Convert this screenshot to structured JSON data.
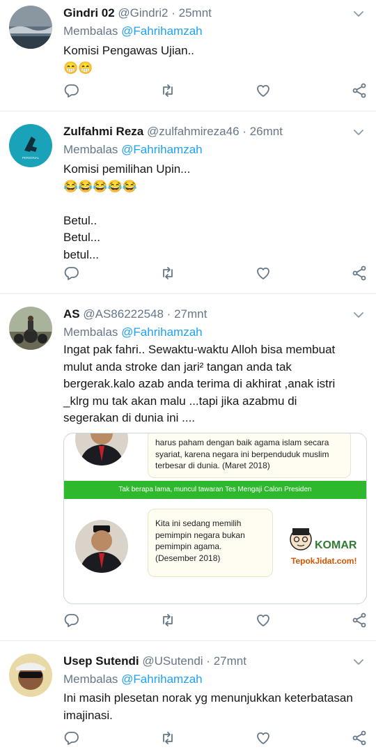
{
  "reply_prefix": "Membalas",
  "colors": {
    "accent": "#1da1f2",
    "muted": "#657786",
    "divider": "#e6ecf0",
    "green_bar": "#2eb82e"
  },
  "icons": {
    "reply": "reply-icon",
    "retweet": "retweet-icon",
    "like": "heart-icon",
    "share": "share-icon",
    "more": "chevron-down-icon"
  },
  "tweets": [
    {
      "name": "Gindri 02",
      "handle": "@Gindri2",
      "sep": "·",
      "time": "25mnt",
      "reply_to": "@Fahrihamzah",
      "text_lines": [
        "Komisi Pengawas Ujian.."
      ],
      "emoji_line": "😁😁"
    },
    {
      "name": "Zulfahmi Reza",
      "handle": "@zulfahmireza46",
      "sep": "·",
      "time": "26mnt",
      "reply_to": "@Fahrihamzah",
      "text_lines": [
        "Komisi pemilihan Upin...",
        "",
        "",
        "Betul..",
        "Betul...",
        "betul..."
      ],
      "emoji_line": "😂😂😂😂😂"
    },
    {
      "name": "AS",
      "handle": "@AS86222548",
      "sep": "·",
      "time": "27mnt",
      "reply_to": "@Fahrihamzah",
      "text_lines": [
        "Ingat pak fahri.. Sewaktu-waktu Alloh bisa membuat",
        "mulut anda stroke dan jari² tangan anda tak",
        "bergerak.kalo azab anda terima di akhirat ,anak istri",
        "_klrg mu tak akan malu ...tapi jika azabmu di",
        "segerakan di dunia ini ...."
      ],
      "card": {
        "top_quote": [
          "harus paham dengan baik agama islam secara",
          "syariat, karena negara ini berpenduduk muslim",
          "terbesar di dunia. (Maret 2018)"
        ],
        "banner": "Tak berapa lama, muncul tawaran Tes Mengaji Calon Presiden",
        "bottom_quote": [
          "Kita ini sedang memilih",
          "pemimpin negara bukan",
          "pemimpin agama.",
          "(Desember 2018)"
        ],
        "brand": "KOMAR",
        "brand_site": "TepokJidat.com!"
      }
    },
    {
      "name": "Usep Sutendi",
      "handle": "@USutendi",
      "sep": "·",
      "time": "27mnt",
      "reply_to": "@Fahrihamzah",
      "text_lines": [
        "Ini masih plesetan norak yg menunjukkan keterbatasan",
        "imajinasi."
      ]
    }
  ]
}
